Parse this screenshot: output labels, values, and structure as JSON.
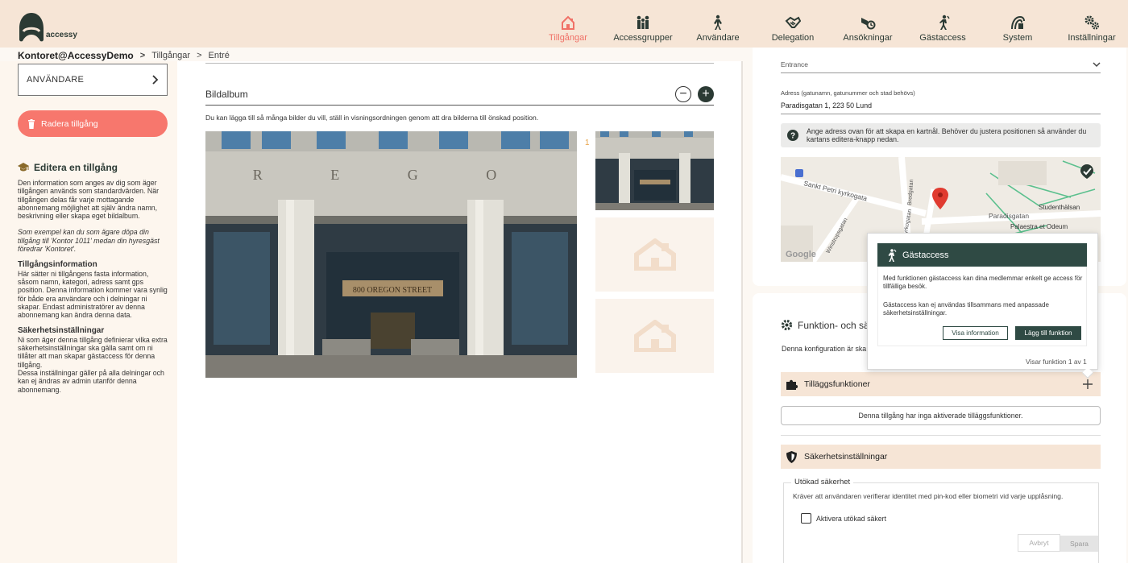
{
  "brand": {
    "name": "accessy"
  },
  "nav": {
    "items": [
      {
        "label": "Tillgångar",
        "icon": "house-icon",
        "active": true
      },
      {
        "label": "Accessgrupper",
        "icon": "group-icon"
      },
      {
        "label": "Användare",
        "icon": "person-icon"
      },
      {
        "label": "Delegation",
        "icon": "handshake-icon"
      },
      {
        "label": "Ansökningar",
        "icon": "application-icon"
      },
      {
        "label": "Gästaccess",
        "icon": "guest-icon"
      },
      {
        "label": "System",
        "icon": "system-icon"
      },
      {
        "label": "Inställningar",
        "icon": "gears-icon"
      }
    ],
    "active_color": "#f07167"
  },
  "breadcrumb": {
    "org": "Kontoret@AccessyDemo",
    "sep": ">",
    "level1": "Tillgångar",
    "level2": "Entré"
  },
  "left": {
    "user_button": "ANVÄNDARE",
    "delete_button": "Radera tillgång",
    "help_title": "Editera en tillgång",
    "help_p1": "Den information som anges av dig som äger tillgången används som standardvärden. När tillgången delas får varje mottagande abonnemang möjlighet att själv ändra namn, beskrivning eller skapa eget bildalbum.",
    "help_p2": "Som exempel kan du som ägare döpa din tillgång till 'Kontor 1011' medan din hyresgäst föredrar 'Kontoret'.",
    "info_title": "Tillgångsinformation",
    "info_text": "Här sätter ni tillgångens fasta information, såsom namn, kategori, adress samt gps position. Denna information kommer vara synlig för både era användare och i delningar ni skapar. Endast administratörer av denna abonnemang kan ändra denna data.",
    "sec_title": "Säkerhetsinställningar",
    "sec_text1": "Ni som äger denna tillgång definierar vilka extra säkerhetsinställningar ska gälla samt om ni tillåter att man skapar gästaccess för denna tillgång.",
    "sec_text2": "Dessa inställningar gäller på alla delningar och kan ej ändras av admin utanför denna abonnemang."
  },
  "album": {
    "title": "Bildalbum",
    "description": "Du kan lägga till så många bilder du vill, ställ in visningsordningen genom att dra bilderna till önskad position.",
    "index_label": "1",
    "remove_symbol": "−",
    "add_symbol": "+",
    "photo_sign": "800 OREGON STREET",
    "photo_letters": "R E G O"
  },
  "right": {
    "category_value": "Entrance",
    "address_label": "Adress (gatunamn, gatunummer och stad behövs)",
    "address_value": "Paradisgatan 1, 223 50 Lund",
    "address_hint": "Ange adress ovan för att skapa en kartnål. Behöver du justera positionen så använder du kartans editera-knapp nedan.",
    "map_labels": {
      "street1": "Sankt Petri kyrkogata",
      "street2": "Bredgatan",
      "street3": "Winstrupsgatan",
      "street4": "Kyrkogatan",
      "street5": "Paradisgatan",
      "place1": "Studenthälsan",
      "place2": "Palaestra et Odeum",
      "google": "Google"
    },
    "func_title": "Funktion- och sä",
    "func_desc": "Denna konfiguration är ska",
    "addons_title": "Tilläggsfunktioner",
    "addons_empty": "Denna tillgång har inga aktiverade tilläggsfunktioner.",
    "security_title": "Säkerhetsinställningar",
    "extended_legend": "Utökad säkerhet",
    "extended_desc": "Kräver att användaren verifierar identitet med pin-kod eller biometri vid varje upplåsning.",
    "extended_checkbox": "Aktivera utökad säkert",
    "cancel": "Avbryt",
    "save": "Spara"
  },
  "popover": {
    "title": "Gästaccess",
    "p1": "Med funktionen gästaccess kan dina medlemmar enkelt ge access för tillfälliga besök.",
    "p2": "Gästaccess kan ej användas tillsammans med anpassade säkerhetsinställningar.",
    "show_info": "Visa information",
    "add_function": "Lägg till funktion",
    "footer": "Visar funktion 1 av 1"
  }
}
